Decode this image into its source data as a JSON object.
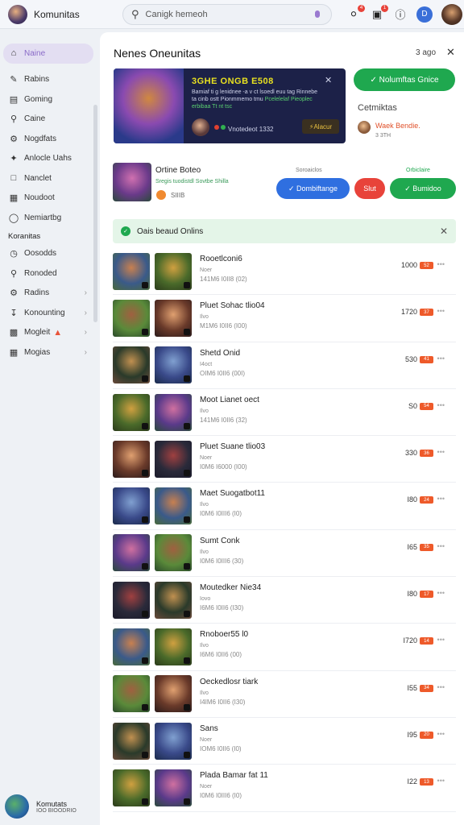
{
  "topbar": {
    "brand": "Komunitas",
    "search_placeholder": "Canigk hemeoh",
    "notif_badge_1": "4",
    "notif_badge_2": "1",
    "user_initial": "D"
  },
  "sidebar": {
    "active_item": "Naine",
    "items": [
      {
        "label": "Rabins",
        "icon": "pencil-icon"
      },
      {
        "label": "Goming",
        "icon": "document-icon"
      },
      {
        "label": "Caine",
        "icon": "pin-icon"
      },
      {
        "label": "Nogdfats",
        "icon": "tools-icon"
      },
      {
        "label": "Anlocle Uahs",
        "icon": "sparkle-icon"
      },
      {
        "label": "Nanclet",
        "icon": "book-icon"
      },
      {
        "label": "Noudoot",
        "icon": "folder-icon"
      },
      {
        "label": "Nemiartbg",
        "icon": "shield-icon"
      }
    ],
    "section_title": "Koranitas",
    "section_items": [
      {
        "label": "Oosodds",
        "icon": "clock-icon",
        "chevron": false
      },
      {
        "label": "Ronoded",
        "icon": "pin-icon",
        "chevron": false
      },
      {
        "label": "Radins",
        "icon": "settings-icon",
        "chevron": true
      },
      {
        "label": "Konounting",
        "icon": "download-icon",
        "chevron": true
      },
      {
        "label": "Mogleit",
        "icon": "image-icon",
        "chevron": true
      },
      {
        "label": "Mogias",
        "icon": "grid-icon",
        "chevron": true
      }
    ],
    "footer": {
      "title": "Komutats",
      "subtitle": "IOO BIOODRIO"
    }
  },
  "panel": {
    "title": "Nenes Oneunitas",
    "age": "3 ago",
    "banner": {
      "title": "3GHE ONGB E508",
      "desc": "Bamiaf ti g lenidnee -a v ct lsoedl euu tag Rinnebe ta cinb ostt Pionmmemo tmu",
      "desc2": "Pcelelelaf Pieoplec erbibaa Tt nt tsc",
      "meta": "Vnotedeot 1332",
      "button": "Alacur"
    },
    "green_button": "Nolumftas Gnice",
    "side_title": "Cetmiktas",
    "side_user": "Waek Bendie.",
    "side_sub": "3 3TH",
    "featured": {
      "title": "Ortine Boteo",
      "subtitle": "Sregis  tuodistdl Sovtbe Shilla",
      "count": "SIIIB",
      "label_left": "Soroaiclos",
      "label_right": "Orbiclaire",
      "btn_blue": "Dombiftange",
      "btn_red": "Slut",
      "btn_green": "Bumidoo"
    },
    "notice": "Oais beaud Onlins",
    "rows": [
      {
        "title": "Rooetlconi6",
        "sub1": "Noer",
        "sub2": "141M6 I0II8 (02)",
        "num": "1000",
        "badge": "52"
      },
      {
        "title": "Pluet Sohac tlio04",
        "sub1": "Ilvo",
        "sub2": "M1M6 I0II6 (I00)",
        "num": "1720",
        "badge": "37"
      },
      {
        "title": "Shetd Onid",
        "sub1": "I4oct",
        "sub2": "OIM6 I0II6 (00I)",
        "num": "530",
        "badge": "41"
      },
      {
        "title": "Moot Lianet oect",
        "sub1": "Ilvo",
        "sub2": "141M6 I0II6 (32)",
        "num": "S0",
        "badge": "54"
      },
      {
        "title": "Pluet Suane tlio03",
        "sub1": "Noer",
        "sub2": "I0M6 I6000 (I00)",
        "num": "330",
        "badge": "36"
      },
      {
        "title": "Maet Suogatbot11",
        "sub1": "Ilvo",
        "sub2": "I0M6 I0III6 (I0)",
        "num": "I80",
        "badge": "24"
      },
      {
        "title": "Sumt Conk",
        "sub1": "Ilvo",
        "sub2": "I0M6 I0III6 (30)",
        "num": "I65",
        "badge": "35"
      },
      {
        "title": "Moutedker Nie34",
        "sub1": "Iovo",
        "sub2": "I6M6 I0II6 (I30)",
        "num": "I80",
        "badge": "17"
      },
      {
        "title": "Rnoboer55 l0",
        "sub1": "Ilvo",
        "sub2": "I6M6 I0II6 (00)",
        "num": "I720",
        "badge": "14"
      },
      {
        "title": "Oeckedlosr tiark",
        "sub1": "Ilvo",
        "sub2": "I4IM6 I0II6 (I30)",
        "num": "I55",
        "badge": "34"
      },
      {
        "title": "Sans",
        "sub1": "Noer",
        "sub2": "IOM6 I0II6 (I0)",
        "num": "I95",
        "badge": "20"
      },
      {
        "title": "Plada Bamar fat 11",
        "sub1": "Noer",
        "sub2": "I0M6 I0III6 (I0)",
        "num": "I22",
        "badge": "13"
      }
    ]
  }
}
